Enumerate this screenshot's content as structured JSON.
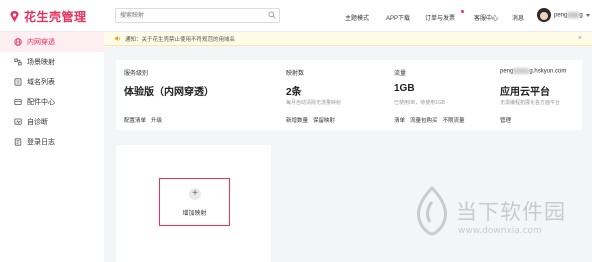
{
  "app": {
    "title": "花生壳管理",
    "brand_color": "#e8315c"
  },
  "search": {
    "placeholder": "搜索映射"
  },
  "topnav": {
    "items": [
      "主题模式",
      "APP下载",
      "订单与发票",
      "客服中心",
      "消息"
    ],
    "user_name_prefix": "peng",
    "user_name_suffix": "g"
  },
  "sidebar": {
    "items": [
      {
        "label": "内网穿透",
        "icon": "globe-icon",
        "active": true
      },
      {
        "label": "场景映射",
        "icon": "scene-icon",
        "active": false
      },
      {
        "label": "域名列表",
        "icon": "domain-list-icon",
        "active": false
      },
      {
        "label": "配件中心",
        "icon": "accessory-icon",
        "active": false
      },
      {
        "label": "自诊断",
        "icon": "diagnose-icon",
        "active": false
      },
      {
        "label": "登录日志",
        "icon": "log-icon",
        "active": false
      }
    ]
  },
  "notice": {
    "text": "通知：关于花生壳禁止使用不符规范的用域名"
  },
  "panel": {
    "service": {
      "label": "服务级别",
      "value": "体验版（内网穿透）",
      "links": [
        "配置清单",
        "升级"
      ]
    },
    "mapping": {
      "label": "映射数",
      "value": "2条",
      "sub": "每月自动清除无流量映射",
      "links": [
        "新增数量",
        "保留映射"
      ]
    },
    "traffic": {
      "label": "流量",
      "value": "1GB",
      "sub": "已使用0B，待使用1GB",
      "links": [
        "清单",
        "流量包购买",
        "不限流量"
      ]
    },
    "account": {
      "email_prefix": "peng",
      "email_suffix": "g.hskyun.com",
      "value": "应用云平台",
      "sub": "无需编程拓展化各方面平台",
      "links": [
        "管理"
      ]
    }
  },
  "card": {
    "add_label": "增加映射"
  },
  "watermark": {
    "title": "当下软件园",
    "url": "www.downxia.com"
  }
}
